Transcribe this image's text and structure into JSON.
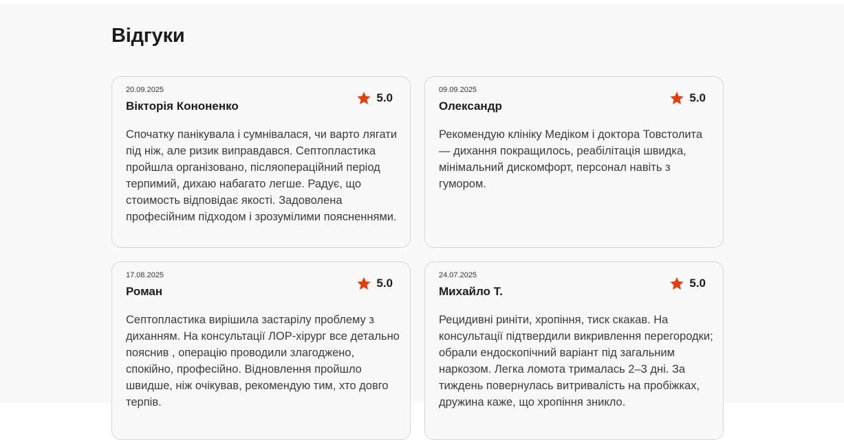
{
  "section": {
    "title": "Відгуки"
  },
  "colors": {
    "star": "#e0400f",
    "background": "#f8f8f8",
    "card_border": "#d6d6d6"
  },
  "reviews": [
    {
      "date": "20.09.2025",
      "author": "Вікторія Кононенко",
      "rating": "5.0",
      "text": "Спочатку панікувала і сумнівалася, чи варто лягати під ніж, але ризик виправдався. Септопластика пройшла організовано, післяопераційний період терпимий, дихаю набагато легше. Радує, що стоимость відповідає якості. Задоволена професійним підходом і зрозумілими поясненнями."
    },
    {
      "date": "09.09.2025",
      "author": "Олександр",
      "rating": "5.0",
      "text": "Рекомендую клініку Медіком і доктора Товстолита — дихання покращилось, реабілітація швидка, мінімальний дискомфорт, персонал навіть з гумором."
    },
    {
      "date": "17.08.2025",
      "author": "Роман",
      "rating": "5.0",
      "text": "Септопластика вирішила застарілу проблему з диханням. На консультації ЛОР-хірург все детально пояснив , операцію проводили злагоджено, спокійно, професійно. Відновлення пройшло швидше, ніж очікував, рекомендую тим, хто довго терпів."
    },
    {
      "date": "24.07.2025",
      "author": "Михайло Т.",
      "rating": "5.0",
      "text": "Рецидивні риніти, хропіння, тиск скакав. На консультації підтвердили викривлення перегородки; обрали ендоскопічний варіант під загальним наркозом. Легка ломота трималась 2–3 дні. За тиждень повернулась витривалість на пробіжках, дружина каже, що хропіння зникло."
    }
  ]
}
